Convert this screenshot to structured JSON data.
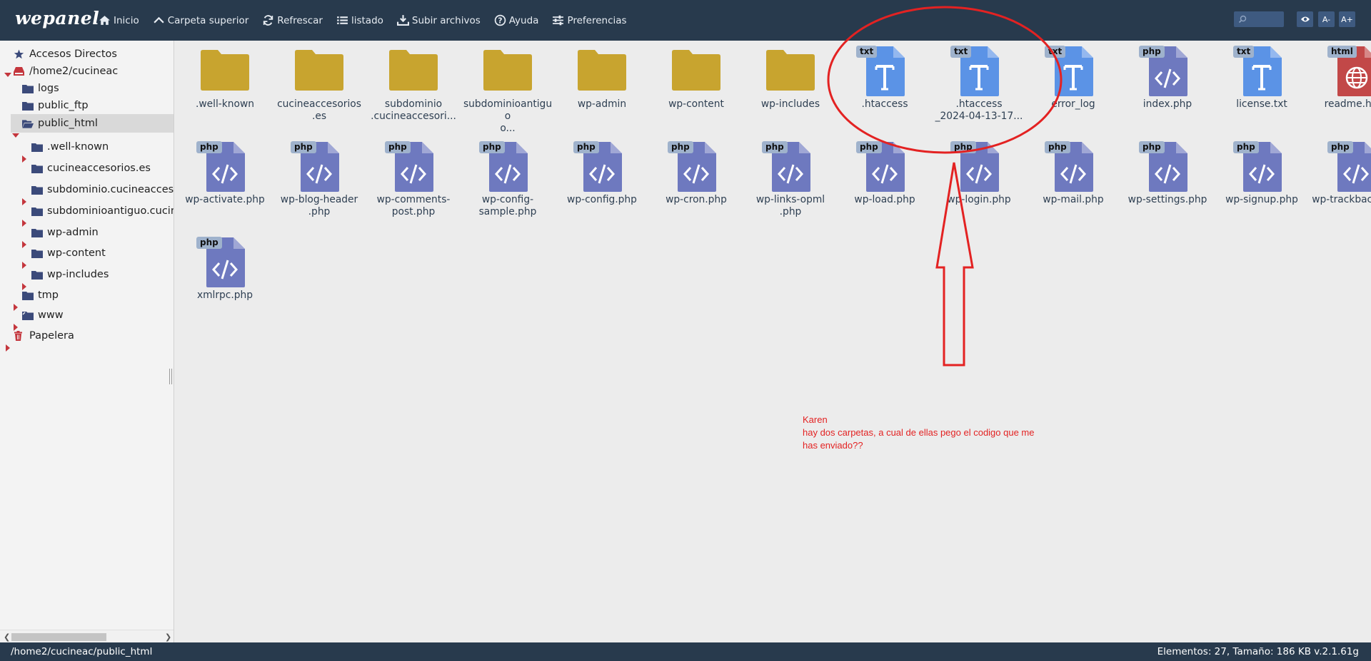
{
  "app": {
    "brand": "wepanel"
  },
  "toolbar": {
    "items": [
      {
        "label": "Inicio",
        "icon": "home-icon"
      },
      {
        "label": "Carpeta superior",
        "icon": "chevron-up-icon"
      },
      {
        "label": "Refrescar",
        "icon": "refresh-icon"
      },
      {
        "label": "listado",
        "icon": "list-icon"
      },
      {
        "label": "Subir archivos",
        "icon": "upload-icon"
      },
      {
        "label": "Ayuda",
        "icon": "help-icon"
      },
      {
        "label": "Preferencias",
        "icon": "sliders-icon"
      }
    ],
    "search_icon": "search-icon",
    "eye_icon": "eye-icon",
    "font_decrease": "A-",
    "font_increase": "A+"
  },
  "sidebar": {
    "shortcuts": "Accesos Directos",
    "root": "/home2/cucineac",
    "items": [
      "logs",
      "public_ftp",
      "public_html",
      ".well-known",
      "cucineaccesorios.es",
      "subdominio.cucineaccesorios.es",
      "subdominioantiguo.cucineaccesorios.es",
      "wp-admin",
      "wp-content",
      "wp-includes",
      "tmp",
      "www"
    ],
    "trash": "Papelera"
  },
  "files": [
    {
      "name": ".well-known",
      "type": "folder"
    },
    {
      "name": "cucineaccesorios\n.es",
      "type": "folder"
    },
    {
      "name": "subdominio\n.cucineaccesori...",
      "type": "folder"
    },
    {
      "name": "subdominioantiguo\no...",
      "type": "folder"
    },
    {
      "name": "wp-admin",
      "type": "folder"
    },
    {
      "name": "wp-content",
      "type": "folder"
    },
    {
      "name": "wp-includes",
      "type": "folder"
    },
    {
      "name": ".htaccess",
      "type": "txt"
    },
    {
      "name": ".htaccess\n_2024-04-13-17...",
      "type": "txt"
    },
    {
      "name": "error_log",
      "type": "txt"
    },
    {
      "name": "index.php",
      "type": "php"
    },
    {
      "name": "license.txt",
      "type": "txt"
    },
    {
      "name": "readme.html",
      "type": "html"
    },
    {
      "name": "wp-activate.php",
      "type": "php"
    },
    {
      "name": "wp-blog-header\n.php",
      "type": "php"
    },
    {
      "name": "wp-comments-\npost.php",
      "type": "php"
    },
    {
      "name": "wp-config-\nsample.php",
      "type": "php"
    },
    {
      "name": "wp-config.php",
      "type": "php"
    },
    {
      "name": "wp-cron.php",
      "type": "php"
    },
    {
      "name": "wp-links-opml\n.php",
      "type": "php"
    },
    {
      "name": "wp-load.php",
      "type": "php"
    },
    {
      "name": "wp-login.php",
      "type": "php"
    },
    {
      "name": "wp-mail.php",
      "type": "php"
    },
    {
      "name": "wp-settings.php",
      "type": "php"
    },
    {
      "name": "wp-signup.php",
      "type": "php"
    },
    {
      "name": "wp-trackback.php",
      "type": "php"
    },
    {
      "name": "xmlrpc.php",
      "type": "php"
    }
  ],
  "badges": {
    "txt": "txt",
    "php": "php",
    "html": "html"
  },
  "annotation": {
    "lines": [
      "Karen",
      "hay dos carpetas, a cual de ellas pego el codigo que me",
      "has enviado??"
    ],
    "color": "#e32222"
  },
  "status": {
    "path": "/home2/cucineac/public_html",
    "info": "Elementos: 27, Tamaño: 186 KB v.2.1.61g"
  },
  "colors": {
    "topbar": "#283a4d",
    "folder": "#c8a42f",
    "txt": "#5b93e6",
    "php": "#6e79bf",
    "html": "#c24848",
    "tree_folder": "#3b4a7a",
    "caret": "#c4363d"
  }
}
